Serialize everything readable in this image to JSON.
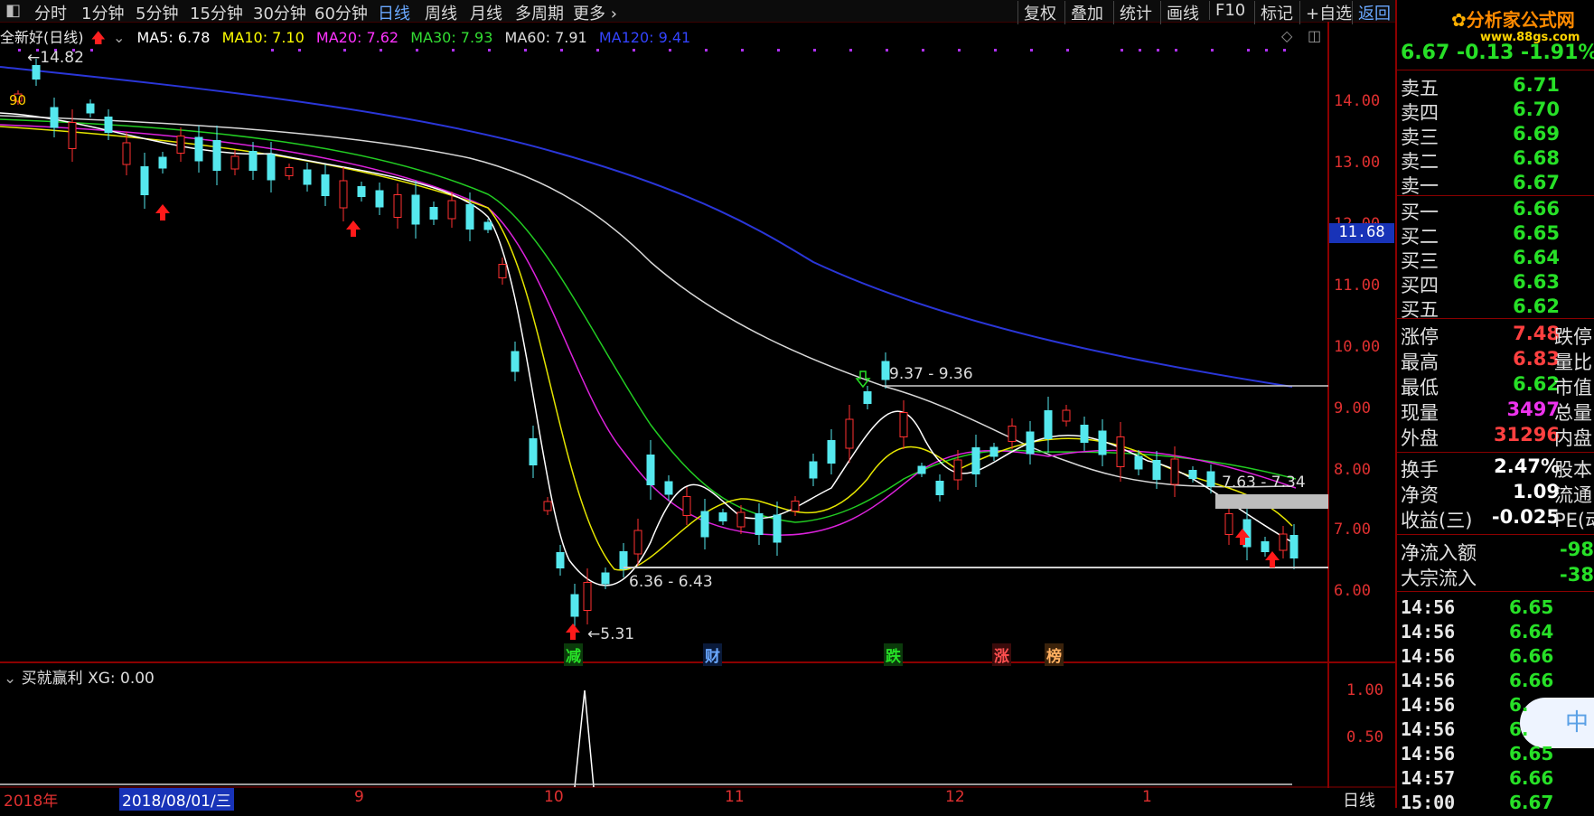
{
  "toolbar": {
    "periods": [
      "分时",
      "1分钟",
      "5分钟",
      "15分钟",
      "30分钟",
      "60分钟",
      "日线",
      "周线",
      "月线",
      "多周期",
      "更多"
    ],
    "active_period": "日线",
    "right_buttons": [
      "复权",
      "叠加",
      "统计",
      "画线",
      "F10",
      "标记",
      "+自选",
      "返回"
    ]
  },
  "stock": {
    "name": "全新好(日线)",
    "ma": [
      {
        "label": "MA5: 6.78",
        "color": "#ffffff"
      },
      {
        "label": "MA10: 7.10",
        "color": "#ffff00"
      },
      {
        "label": "MA20: 7.62",
        "color": "#ff33ff"
      },
      {
        "label": "MA30: 7.93",
        "color": "#33dd33"
      },
      {
        "label": "MA60: 7.91",
        "color": "#dddddd"
      },
      {
        "label": "MA120: 9.41",
        "color": "#3344ff"
      }
    ]
  },
  "price_axis": [
    "14.00",
    "13.00",
    "12.00",
    "11.00",
    "10.00",
    "9.00",
    "8.00",
    "7.00",
    "6.00"
  ],
  "price_axis_tag": "11.68",
  "sub_axis": [
    "1.00",
    "0.50"
  ],
  "chart_data": {
    "type": "candlestick",
    "annotations": {
      "high": "14.82",
      "low": "5.31",
      "range_top": "9.37 - 9.36",
      "range_bottom": "6.36 - 6.43",
      "range_right": "7.63 - 7.34",
      "left_label": "90"
    },
    "event_markers": [
      {
        "text": "减",
        "color": "#27e027",
        "bg": "#0b3a0b"
      },
      {
        "text": "财",
        "color": "#6aa8ff",
        "bg": "#0a1a3a"
      },
      {
        "text": "跌",
        "color": "#27e027",
        "bg": "#0b3a0b"
      },
      {
        "text": "涨",
        "color": "#ff5050",
        "bg": "#3a0b0b"
      },
      {
        "text": "榜",
        "color": "#ffb060",
        "bg": "#3a220b"
      }
    ],
    "x_labels": [
      "2018年",
      "2018/08/01/三",
      "9",
      "10",
      "11",
      "12",
      "1"
    ],
    "ylim": [
      5.0,
      15.0
    ],
    "indicator": {
      "name": "买就赢利",
      "value_label": "XG: 0.00"
    }
  },
  "footer_right": "日线",
  "quote": {
    "price_line": "6.67  -0.13  -1.91%",
    "logo_text": "分析家公式网",
    "logo_url": "www.88gs.com",
    "asks": [
      {
        "label": "卖五",
        "price": "6.71"
      },
      {
        "label": "卖四",
        "price": "6.70"
      },
      {
        "label": "卖三",
        "price": "6.69"
      },
      {
        "label": "卖二",
        "price": "6.68"
      },
      {
        "label": "卖一",
        "price": "6.67"
      }
    ],
    "bids": [
      {
        "label": "买一",
        "price": "6.66"
      },
      {
        "label": "买二",
        "price": "6.65"
      },
      {
        "label": "买三",
        "price": "6.64"
      },
      {
        "label": "买四",
        "price": "6.63"
      },
      {
        "label": "买五",
        "price": "6.62"
      }
    ],
    "stats": [
      {
        "label": "涨停",
        "value": "7.48",
        "color": "#ff4040",
        "extra": "跌停"
      },
      {
        "label": "最高",
        "value": "6.83",
        "color": "#ff4040",
        "extra": "量比"
      },
      {
        "label": "最低",
        "value": "6.62",
        "color": "#27e027",
        "extra": "市值"
      },
      {
        "label": "现量",
        "value": "3497",
        "color": "#ee33ee",
        "extra": "总量"
      },
      {
        "label": "外盘",
        "value": "31296",
        "color": "#ff4040",
        "extra": "内盘"
      }
    ],
    "stats2": [
      {
        "label": "换手",
        "value": "2.47%",
        "color": "#ffffff",
        "extra": "股本"
      },
      {
        "label": "净资",
        "value": "1.09",
        "color": "#ffffff",
        "extra": "流通"
      },
      {
        "label": "收益(三)",
        "value": "-0.025",
        "color": "#ffffff",
        "extra": "PE(动"
      }
    ],
    "flows": [
      {
        "label": "净流入额",
        "value": "-98"
      },
      {
        "label": "大宗流入",
        "value": "-38"
      }
    ],
    "ticks": [
      {
        "time": "14:56",
        "price": "6.65"
      },
      {
        "time": "14:56",
        "price": "6.64"
      },
      {
        "time": "14:56",
        "price": "6.66"
      },
      {
        "time": "14:56",
        "price": "6.66"
      },
      {
        "time": "14:56",
        "price": "6."
      },
      {
        "time": "14:56",
        "price": "6."
      },
      {
        "time": "14:56",
        "price": "6.65"
      },
      {
        "time": "14:57",
        "price": "6.66"
      },
      {
        "time": "15:00",
        "price": "6.67"
      }
    ]
  }
}
